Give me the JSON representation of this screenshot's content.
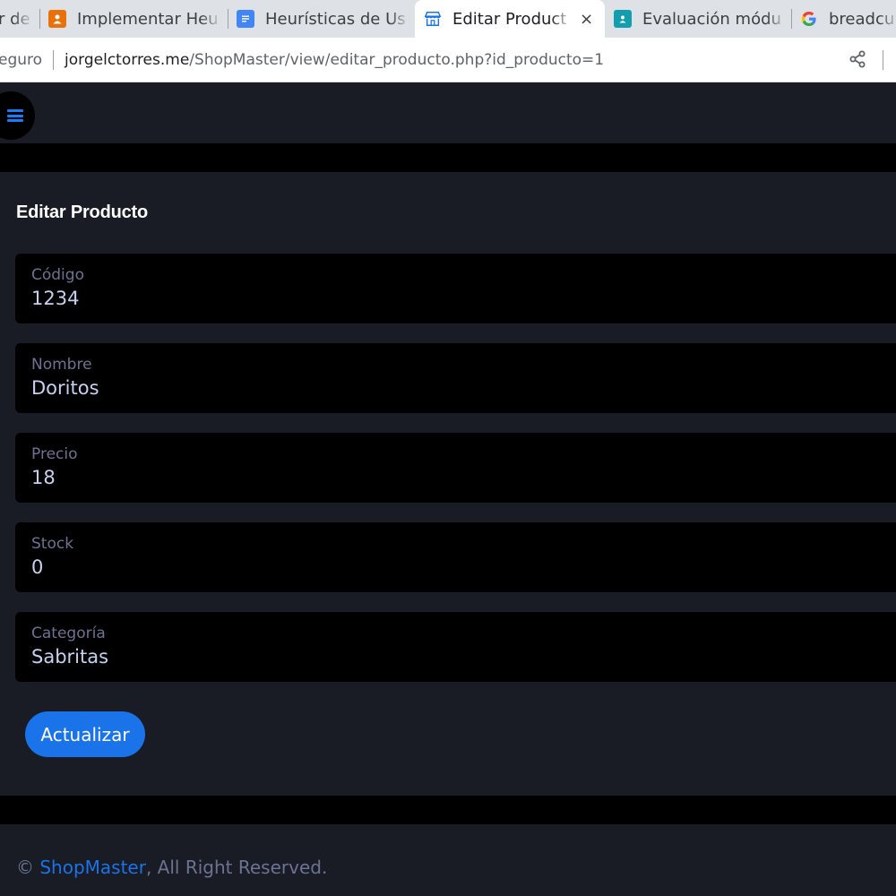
{
  "browser": {
    "tabs": [
      {
        "title": "r de",
        "favicon": "partial-tab",
        "active": false
      },
      {
        "title": "Implementar Heu",
        "favicon": "orange-person-icon",
        "active": false
      },
      {
        "title": "Heurísticas de Us",
        "favicon": "docs-icon",
        "active": false
      },
      {
        "title": "Editar Product",
        "favicon": "store-icon",
        "active": true
      },
      {
        "title": "Evaluación módu",
        "favicon": "classroom-icon",
        "active": false
      },
      {
        "title": "breadcu",
        "favicon": "google-icon",
        "active": false
      }
    ],
    "close_symbol": "×",
    "security_label": "eguro",
    "url_host": "jorgelctorres.me",
    "url_path": "/ShopMaster/view/editar_producto.php?id_producto=1"
  },
  "page": {
    "title": "Editar Producto",
    "fields": [
      {
        "label": "Código",
        "value": "1234"
      },
      {
        "label": "Nombre",
        "value": "Doritos"
      },
      {
        "label": "Precio",
        "value": "18"
      },
      {
        "label": "Stock",
        "value": "0"
      },
      {
        "label": "Categoría",
        "value": "Sabritas"
      }
    ],
    "submit_label": "Actualizar"
  },
  "footer": {
    "copyright": "©",
    "brand": "ShopMaster",
    "rest": ", All Right Reserved."
  },
  "colors": {
    "background": "#191c24",
    "field_bg": "#000000",
    "accent": "#1a73e8",
    "label": "#6c7293"
  }
}
